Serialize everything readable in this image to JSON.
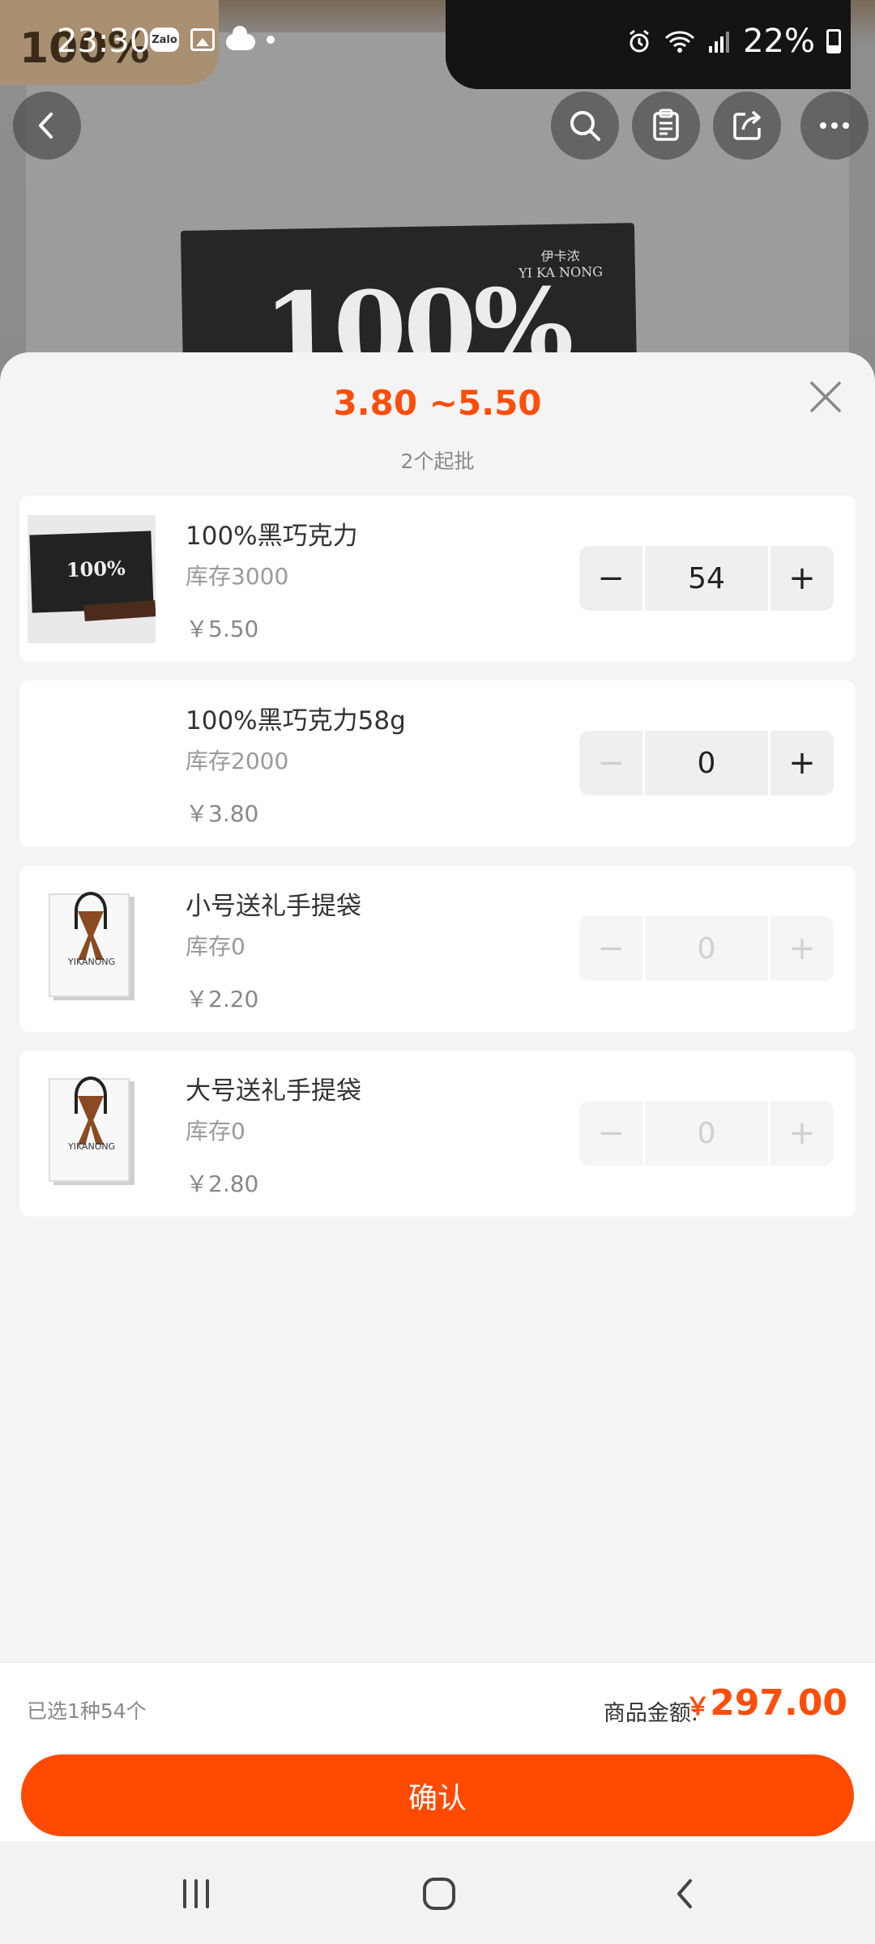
{
  "status_bar": {
    "time": "23:30",
    "battery": "22%",
    "zalo_label": "Zalo"
  },
  "background": {
    "tag": "100%",
    "box_text": "100%",
    "brand_cn": "伊卡浓",
    "brand_en": "YI KA NONG"
  },
  "sheet": {
    "price_range": "3.80 ~5.50",
    "moq": "2个起批"
  },
  "skus": [
    {
      "name": "100%黑巧克力",
      "stock": "库存3000",
      "price": "￥5.50",
      "qty": "54",
      "thumb": "chocolate-box"
    },
    {
      "name": "100%黑巧克力58g",
      "stock": "库存2000",
      "price": "￥3.80",
      "qty": "0",
      "thumb": "none"
    },
    {
      "name": "小号送礼手提袋",
      "stock": "库存0",
      "price": "￥2.20",
      "qty": "0",
      "thumb": "gift-bag"
    },
    {
      "name": "大号送礼手提袋",
      "stock": "库存0",
      "price": "￥2.80",
      "qty": "0",
      "thumb": "gift-bag"
    }
  ],
  "stepper": {
    "minus": "−",
    "plus": "+"
  },
  "footer": {
    "selection_summary": "已选1种54个",
    "total_label": "商品金额:",
    "currency": "￥",
    "total_value": "297.00",
    "confirm_label": "确认"
  },
  "colors": {
    "accent": "#ff4a00",
    "price": "#ff4d0a"
  },
  "icons": [
    "back-icon",
    "search-icon",
    "clipboard-icon",
    "share-icon",
    "more-icon",
    "close-icon"
  ]
}
